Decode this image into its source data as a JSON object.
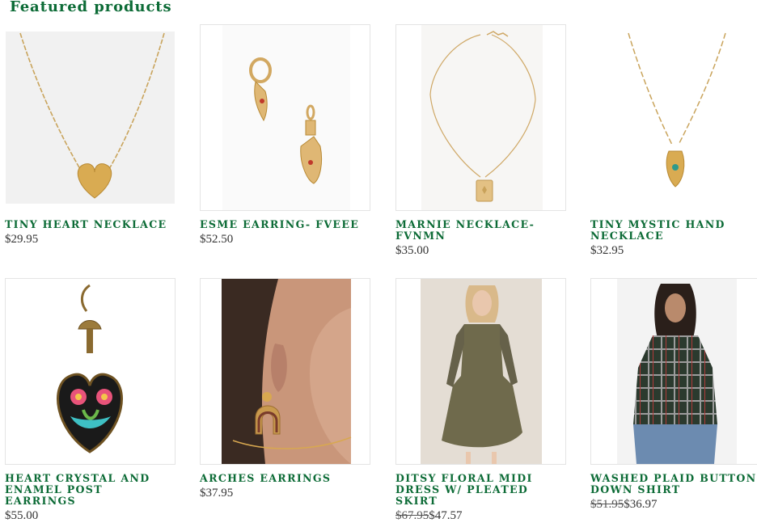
{
  "section": {
    "title": "Featured products"
  },
  "colors": {
    "accent": "#0c6b36",
    "price": "#333333",
    "border": "#e4e4e4"
  },
  "products": [
    {
      "name": "TINY HEART NECKLACE",
      "price": "$29.95",
      "image_icon": "heart-necklace-image"
    },
    {
      "name": "ESME EARRING- FVEEE",
      "price": "$52.50",
      "image_icon": "hand-earrings-image"
    },
    {
      "name": "MARNIE NECKLACE-FVNMN",
      "price": "$35.00",
      "image_icon": "pendant-necklace-image"
    },
    {
      "name": "TINY MYSTIC HAND NECKLACE",
      "price": "$32.95",
      "image_icon": "hamsa-necklace-image"
    },
    {
      "name": "HEART CRYSTAL AND ENAMEL POST EARRINGS",
      "price": "$55.00",
      "image_icon": "enamel-heart-earring-image"
    },
    {
      "name": "ARCHES EARRINGS",
      "price": "$37.95",
      "image_icon": "arch-earring-model-image"
    },
    {
      "name": "DITSY FLORAL MIDI DRESS W/ PLEATED SKIRT",
      "old_price": "$67.95",
      "price": "$47.57",
      "image_icon": "floral-dress-model-image"
    },
    {
      "name": "WASHED PLAID BUTTON DOWN SHIRT",
      "old_price": "$51.95",
      "price": "$36.97",
      "image_icon": "plaid-shirt-model-image"
    }
  ]
}
